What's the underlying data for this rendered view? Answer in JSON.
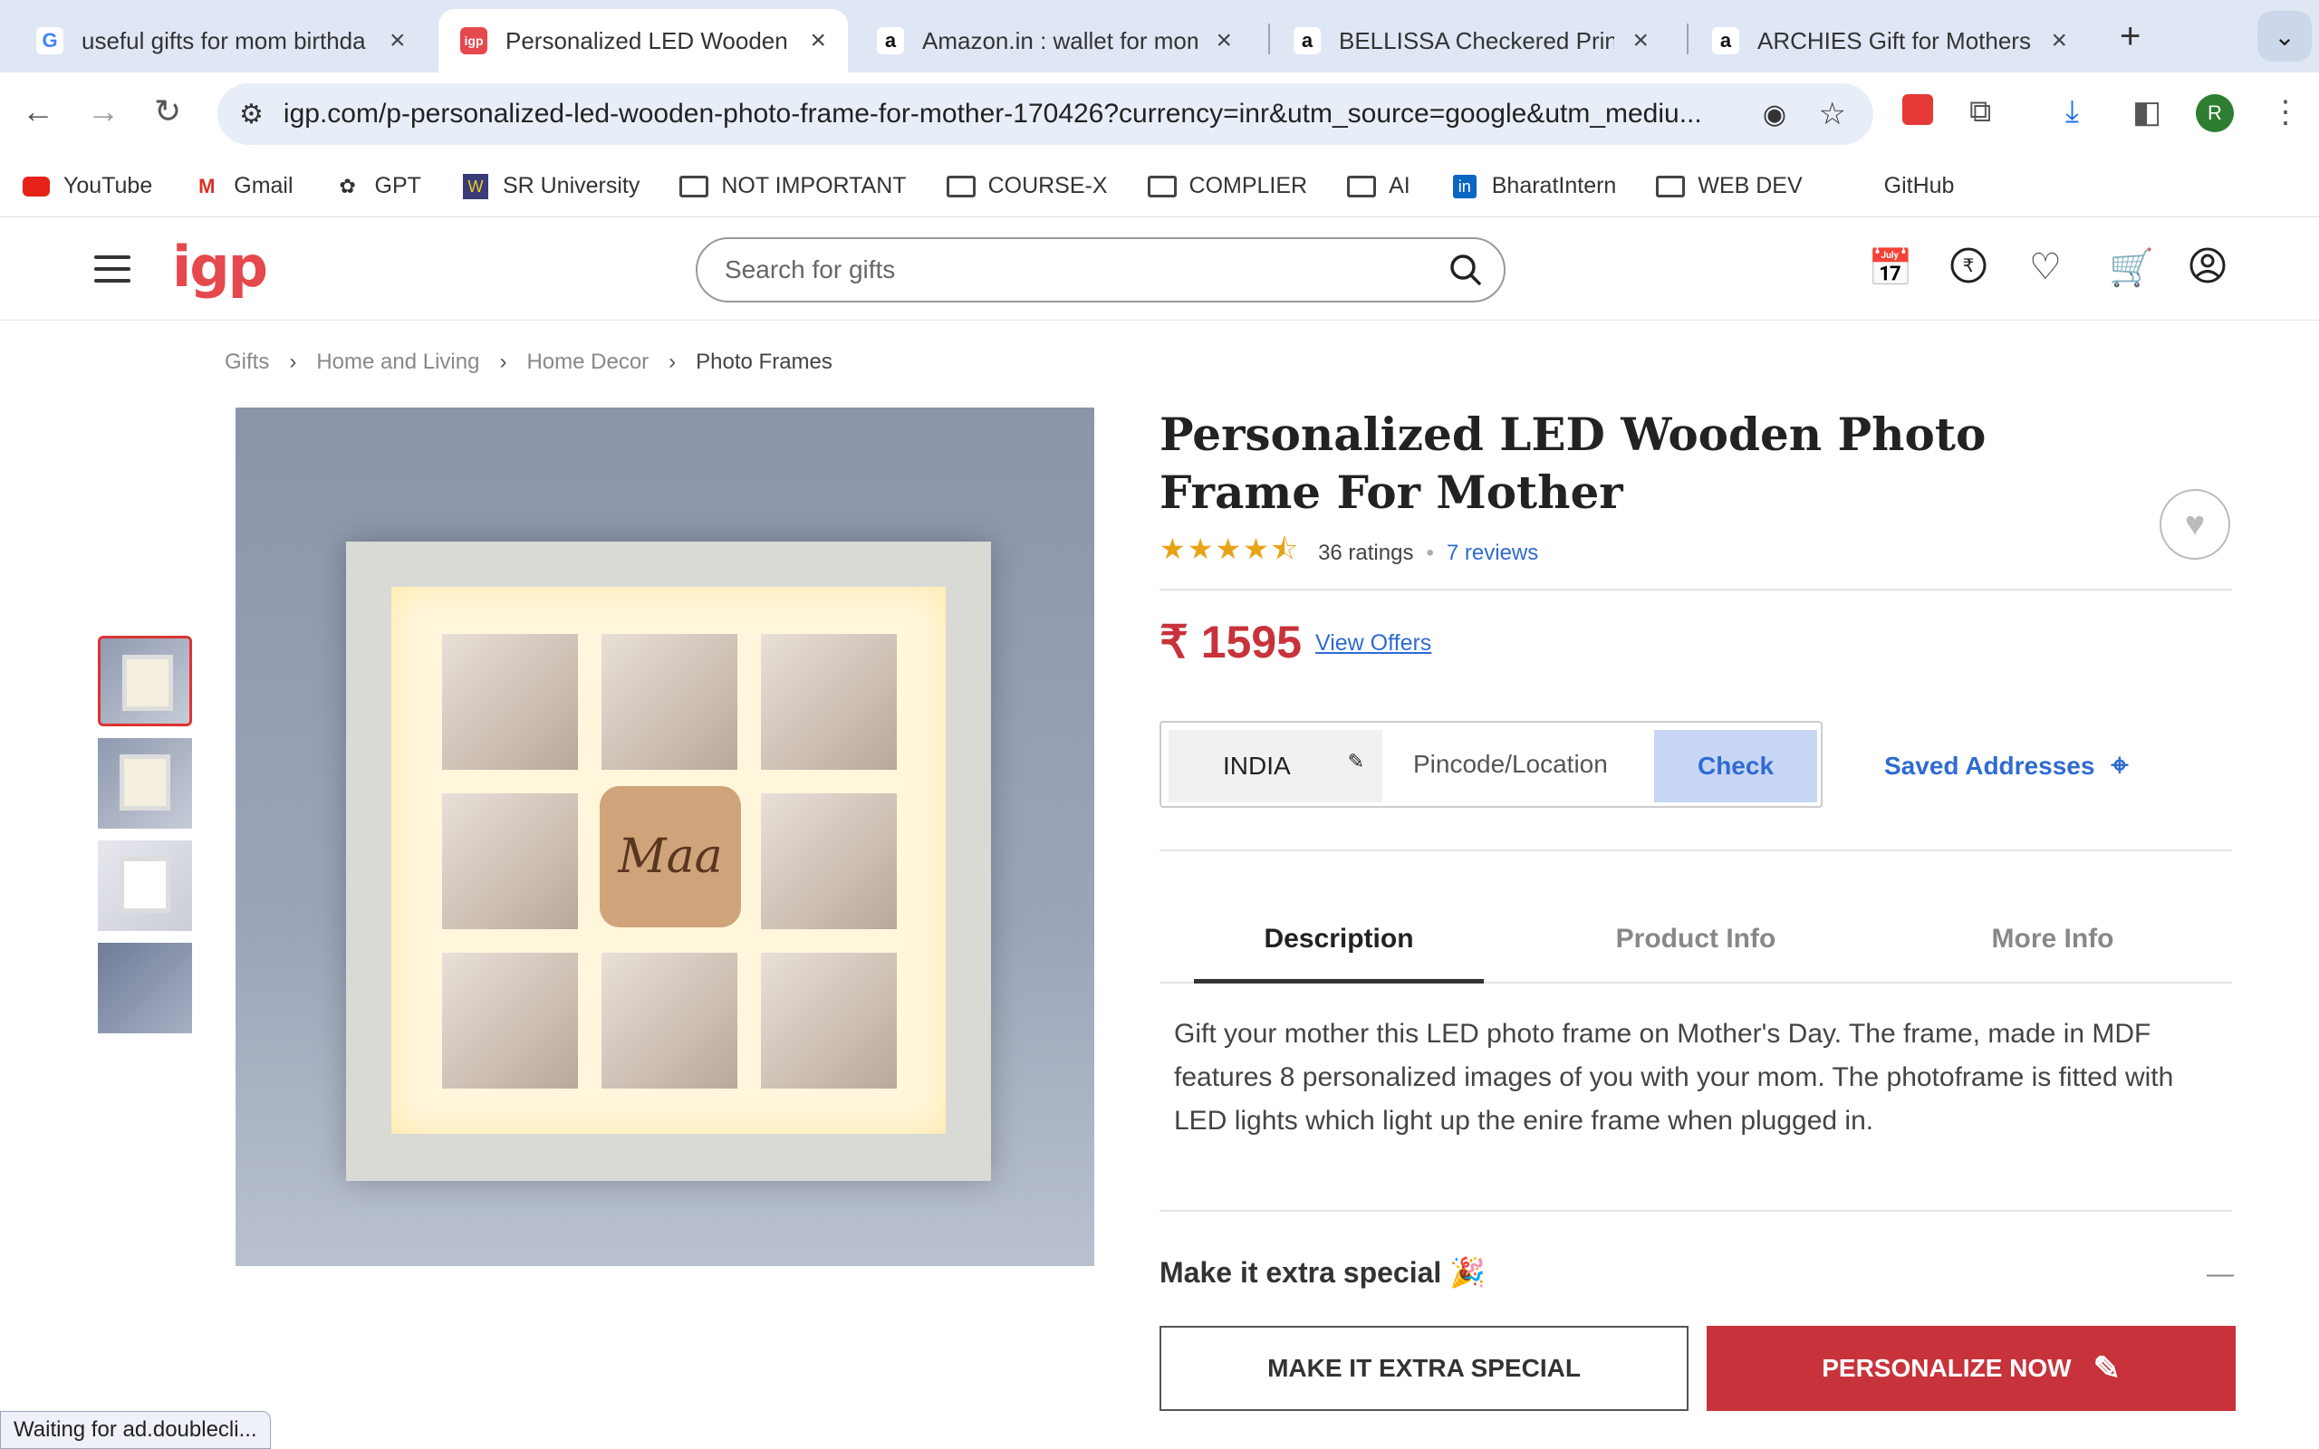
{
  "browser": {
    "tabs": [
      {
        "title": "useful gifts for mom birthda",
        "favicon": "G"
      },
      {
        "title": "Personalized LED Wooden P",
        "favicon": "igp"
      },
      {
        "title": "Amazon.in : wallet for mom",
        "favicon": "a"
      },
      {
        "title": "BELLISSA Checkered Printe",
        "favicon": "a"
      },
      {
        "title": "ARCHIES Gift for Mothers | ",
        "favicon": "a"
      }
    ],
    "url": "igp.com/p-personalized-led-wooden-photo-frame-for-mother-170426?currency=inr&utm_source=google&utm_mediu...",
    "profile_initial": "R",
    "bookmarks": [
      {
        "label": "YouTube",
        "icon": "youtube-icon"
      },
      {
        "label": "Gmail",
        "icon": "gmail-icon"
      },
      {
        "label": "GPT",
        "icon": "gpt-icon"
      },
      {
        "label": "SR University",
        "icon": "sr-university-icon"
      },
      {
        "label": "NOT IMPORTANT",
        "icon": "folder-icon"
      },
      {
        "label": "COURSE-X",
        "icon": "folder-icon"
      },
      {
        "label": "COMPLIER",
        "icon": "folder-icon"
      },
      {
        "label": "AI",
        "icon": "folder-icon"
      },
      {
        "label": "BharatIntern",
        "icon": "linkedin-icon"
      },
      {
        "label": "WEB DEV",
        "icon": "folder-icon"
      },
      {
        "label": "GitHub",
        "icon": ""
      }
    ],
    "status_text": "Waiting for ad.doublecli..."
  },
  "site": {
    "logo": "igp",
    "search_placeholder": "Search for gifts"
  },
  "breadcrumb": [
    "Gifts",
    "Home and Living",
    "Home Decor",
    "Photo Frames"
  ],
  "product": {
    "title": "Personalized LED Wooden Photo Frame For Mother",
    "stars": "★★★★⯪",
    "rating": 4.5,
    "ratings_count": "36 ratings",
    "reviews": "7 reviews",
    "price": "₹ 1595",
    "view_offers": "View Offers",
    "frame_logo_text": "Maa"
  },
  "delivery": {
    "country": "INDIA",
    "pincode_placeholder": "Pincode/Location",
    "check_label": "Check",
    "saved_addresses": "Saved Addresses"
  },
  "info_tabs": [
    "Description",
    "Product Info",
    "More Info"
  ],
  "description": "Gift your mother this LED photo frame on Mother's Day. The frame, made in MDF features 8 personalized images of you with your mom. The photoframe is fitted with LED lights which light up the enire frame when plugged in.",
  "extra": {
    "heading": "Make it extra special",
    "emoji": "🎉",
    "collapse": "—"
  },
  "actions": {
    "extra_special": "MAKE IT EXTRA SPECIAL",
    "personalize": "PERSONALIZE NOW"
  },
  "colors": {
    "brand": "#e5484d",
    "price": "#c8323a",
    "link": "#2f6bd1"
  }
}
